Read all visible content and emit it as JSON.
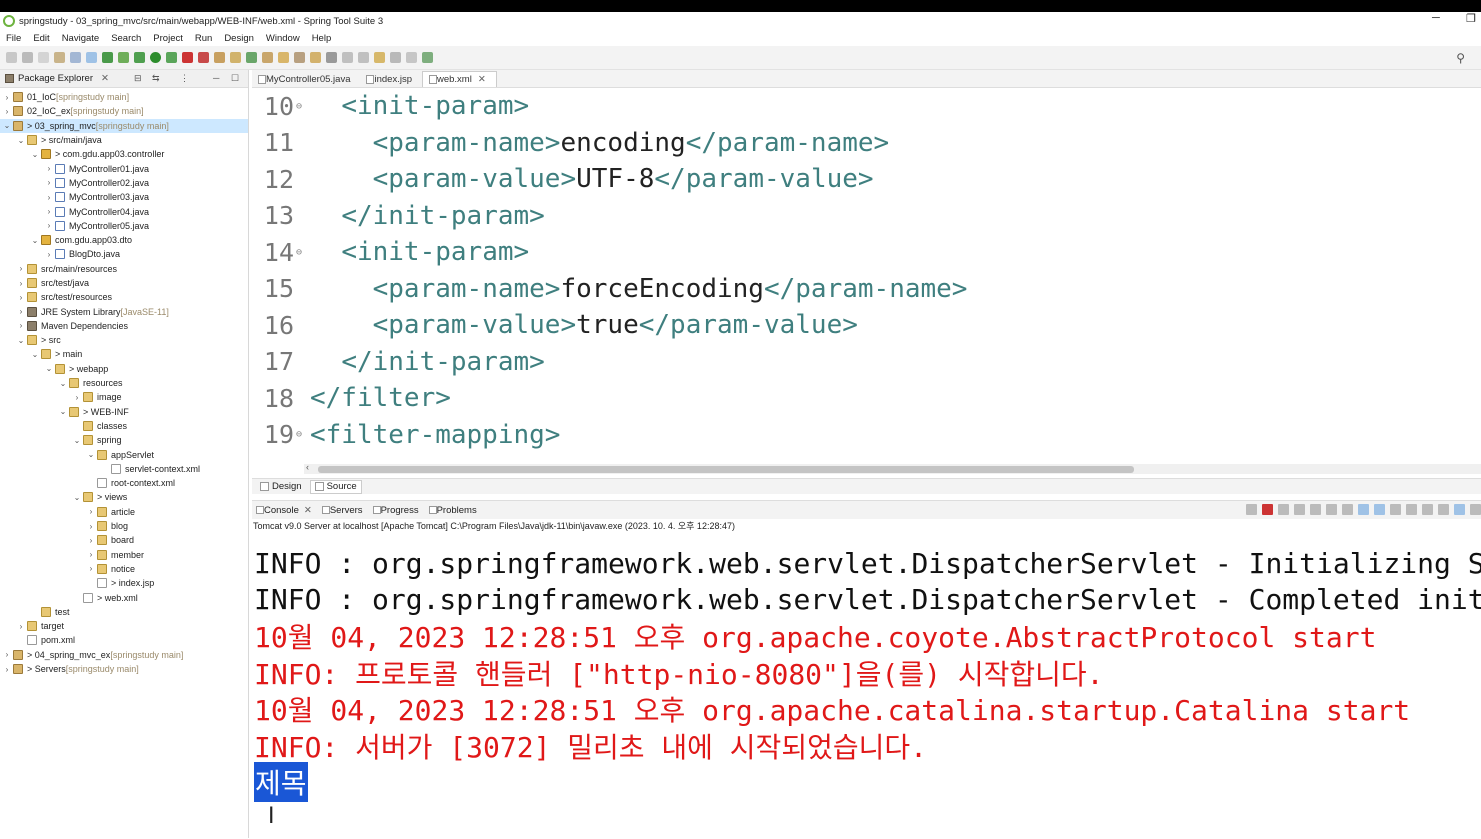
{
  "window": {
    "title": "springstudy - 03_spring_mvc/src/main/webapp/WEB-INF/web.xml - Spring Tool Suite 3",
    "minimize": "─",
    "restore": "❐"
  },
  "menu": [
    "File",
    "Edit",
    "Navigate",
    "Search",
    "Project",
    "Run",
    "Design",
    "Window",
    "Help"
  ],
  "package_explorer": {
    "title": "Package Explorer",
    "rows": [
      {
        "tw": "›",
        "icon": "proj",
        "label": "01_IoC",
        "extra": "[springstudy main]"
      },
      {
        "tw": "›",
        "icon": "proj",
        "label": "02_IoC_ex",
        "extra": "[springstudy main]"
      },
      {
        "tw": "⌄",
        "icon": "proj",
        "label": "> 03_spring_mvc",
        "extra": "[springstudy main]",
        "selected": true
      },
      {
        "tw": "⌄",
        "icon": "fold",
        "label": "> src/main/java"
      },
      {
        "tw": "⌄",
        "icon": "pkg",
        "label": "> com.gdu.app03.controller"
      },
      {
        "tw": "›",
        "icon": "java",
        "label": "MyController01.java"
      },
      {
        "tw": "›",
        "icon": "java",
        "label": "MyController02.java"
      },
      {
        "tw": "›",
        "icon": "java",
        "label": "MyController03.java"
      },
      {
        "tw": "›",
        "icon": "java",
        "label": "MyController04.java"
      },
      {
        "tw": "›",
        "icon": "java",
        "label": "MyController05.java"
      },
      {
        "tw": "⌄",
        "icon": "pkg",
        "label": "com.gdu.app03.dto"
      },
      {
        "tw": "›",
        "icon": "java",
        "label": "BlogDto.java"
      },
      {
        "tw": "›",
        "icon": "fold",
        "label": "src/main/resources"
      },
      {
        "tw": "›",
        "icon": "fold",
        "label": "src/test/java"
      },
      {
        "tw": "›",
        "icon": "fold",
        "label": "src/test/resources"
      },
      {
        "tw": "›",
        "icon": "lib",
        "label": "JRE System Library",
        "extra": "[JavaSE-11]"
      },
      {
        "tw": "›",
        "icon": "lib",
        "label": "Maven Dependencies"
      },
      {
        "tw": "⌄",
        "icon": "fold",
        "label": "> src"
      },
      {
        "tw": "⌄",
        "icon": "fold",
        "label": "> main"
      },
      {
        "tw": "⌄",
        "icon": "fold",
        "label": "> webapp"
      },
      {
        "tw": "⌄",
        "icon": "fold",
        "label": "resources"
      },
      {
        "tw": "›",
        "icon": "fold",
        "label": "image"
      },
      {
        "tw": "⌄",
        "icon": "fold",
        "label": "> WEB-INF"
      },
      {
        "tw": "",
        "icon": "fold",
        "label": "classes"
      },
      {
        "tw": "⌄",
        "icon": "fold",
        "label": "spring"
      },
      {
        "tw": "⌄",
        "icon": "fold",
        "label": "appServlet"
      },
      {
        "tw": "",
        "icon": "file",
        "label": "servlet-context.xml"
      },
      {
        "tw": "",
        "icon": "file",
        "label": "root-context.xml"
      },
      {
        "tw": "⌄",
        "icon": "fold",
        "label": "> views"
      },
      {
        "tw": "›",
        "icon": "fold",
        "label": "article"
      },
      {
        "tw": "›",
        "icon": "fold",
        "label": "blog"
      },
      {
        "tw": "›",
        "icon": "fold",
        "label": "board"
      },
      {
        "tw": "›",
        "icon": "fold",
        "label": "member"
      },
      {
        "tw": "›",
        "icon": "fold",
        "label": "notice"
      },
      {
        "tw": "",
        "icon": "file",
        "label": "> index.jsp"
      },
      {
        "tw": "",
        "icon": "file",
        "label": "> web.xml"
      },
      {
        "tw": "",
        "icon": "fold",
        "label": "test"
      },
      {
        "tw": "›",
        "icon": "fold",
        "label": "target"
      },
      {
        "tw": "",
        "icon": "file",
        "label": "pom.xml"
      },
      {
        "tw": "›",
        "icon": "proj",
        "label": "> 04_spring_mvc_ex",
        "extra": "[springstudy main]"
      },
      {
        "tw": "›",
        "icon": "proj",
        "label": "> Servers",
        "extra": "[springstudy main]"
      }
    ]
  },
  "editor": {
    "tabs": [
      {
        "label": "MyController05.java",
        "active": false
      },
      {
        "label": "index.jsp",
        "active": false
      },
      {
        "label": "web.xml",
        "active": true
      }
    ],
    "lines": [
      {
        "n": "10",
        "fold": "⊖",
        "text": "  <init-param>"
      },
      {
        "n": "11",
        "fold": "",
        "text": "    <param-name>encoding</param-name>"
      },
      {
        "n": "12",
        "fold": "",
        "text": "    <param-value>UTF-8</param-value>"
      },
      {
        "n": "13",
        "fold": "",
        "text": "  </init-param>"
      },
      {
        "n": "14",
        "fold": "⊖",
        "text": "  <init-param>"
      },
      {
        "n": "15",
        "fold": "",
        "text": "    <param-name>forceEncoding</param-name>"
      },
      {
        "n": "16",
        "fold": "",
        "text": "    <param-value>true</param-value>"
      },
      {
        "n": "17",
        "fold": "",
        "text": "  </init-param>"
      },
      {
        "n": "18",
        "fold": "",
        "text": "</filter>"
      },
      {
        "n": "19",
        "fold": "⊖",
        "text": "<filter-mapping>"
      }
    ],
    "design_tab": "Design",
    "source_tab": "Source"
  },
  "console": {
    "tabs": [
      {
        "label": "Console",
        "active": true
      },
      {
        "label": "Servers",
        "active": false
      },
      {
        "label": "Progress",
        "active": false
      },
      {
        "label": "Problems",
        "active": false
      }
    ],
    "description": "Tomcat v9.0 Server at localhost [Apache Tomcat] C:\\Program Files\\Java\\jdk-11\\bin\\javaw.exe  (2023. 10. 4. 오후 12:28:47)",
    "lines": [
      {
        "color": "black",
        "text": "INFO : org.springframework.web.servlet.DispatcherServlet - Initializing Servl"
      },
      {
        "color": "black",
        "text": "INFO : org.springframework.web.servlet.DispatcherServlet - Completed initiali"
      },
      {
        "color": "red",
        "text": "10월 04, 2023 12:28:51 오후 org.apache.coyote.AbstractProtocol start"
      },
      {
        "color": "red",
        "text": "INFO: 프로토콜 핸들러 [\"http-nio-8080\"]을(를) 시작합니다."
      },
      {
        "color": "red",
        "text": "10월 04, 2023 12:28:51 오후 org.apache.catalina.startup.Catalina start"
      },
      {
        "color": "red",
        "text": "INFO: 서버가 [3072] 밀리초 내에 시작되었습니다."
      }
    ],
    "input_text": "제목"
  }
}
